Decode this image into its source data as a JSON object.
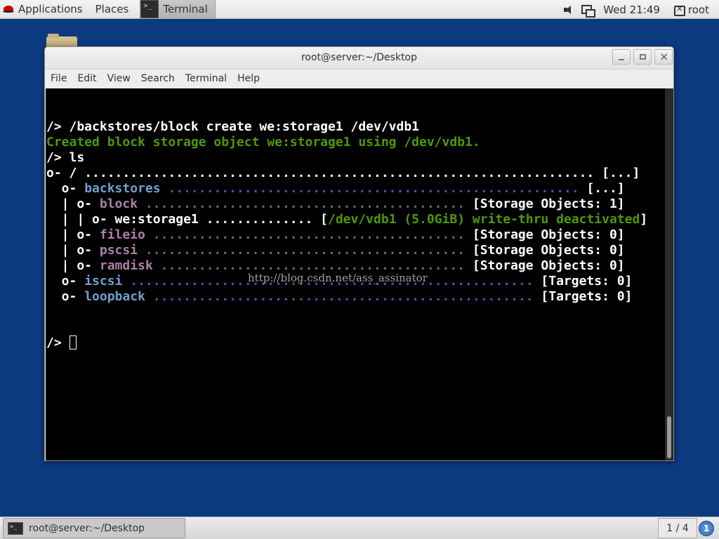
{
  "topbar": {
    "applications": "Applications",
    "places": "Places",
    "terminal_task": "Terminal",
    "clock": "Wed 21:49",
    "user": "root"
  },
  "window": {
    "title": "root@server:~/Desktop",
    "menus": [
      "File",
      "Edit",
      "View",
      "Search",
      "Terminal",
      "Help"
    ]
  },
  "terminal": {
    "lines": [
      {
        "segments": [
          {
            "text": "/> /backstores/block create we:storage1 /dev/vdb1",
            "color": "white"
          }
        ]
      },
      {
        "segments": [
          {
            "text": "Created block storage object we:storage1 using /dev/vdb1.",
            "color": "green"
          }
        ]
      },
      {
        "segments": [
          {
            "text": "/> ls",
            "color": "white"
          }
        ]
      },
      {
        "segments": [
          {
            "text": "o- / ",
            "color": "white"
          },
          {
            "text": "................................................................... ",
            "color": "white"
          },
          {
            "text": "[...]",
            "color": "white"
          }
        ]
      },
      {
        "segments": [
          {
            "text": "  o- ",
            "color": "white"
          },
          {
            "text": "backstores",
            "color": "blue"
          },
          {
            "text": " ...................................................... ",
            "color": "dots-blue"
          },
          {
            "text": "[...]",
            "color": "white"
          }
        ]
      },
      {
        "segments": [
          {
            "text": "  | o- ",
            "color": "white"
          },
          {
            "text": "block",
            "color": "purple"
          },
          {
            "text": " .......................................... ",
            "color": "dots-gray"
          },
          {
            "text": "[Storage Objects: 1]",
            "color": "white"
          }
        ]
      },
      {
        "segments": [
          {
            "text": "  | | o- ",
            "color": "white"
          },
          {
            "text": "we:storage1",
            "color": "white"
          },
          {
            "text": " .............. ",
            "color": "white"
          },
          {
            "text": "[",
            "color": "white"
          },
          {
            "text": "/dev/vdb1 (5.0GiB) write-thru deactivated",
            "color": "green"
          },
          {
            "text": "]",
            "color": "white"
          }
        ]
      },
      {
        "segments": [
          {
            "text": "  | o- ",
            "color": "white"
          },
          {
            "text": "fileio",
            "color": "purple"
          },
          {
            "text": " ......................................... ",
            "color": "dots-gray"
          },
          {
            "text": "[Storage Objects: 0]",
            "color": "white"
          }
        ]
      },
      {
        "segments": [
          {
            "text": "  | o- ",
            "color": "white"
          },
          {
            "text": "pscsi",
            "color": "purple"
          },
          {
            "text": " .......................................... ",
            "color": "dots-gray"
          },
          {
            "text": "[Storage Objects: 0]",
            "color": "white"
          }
        ]
      },
      {
        "segments": [
          {
            "text": "  | o- ",
            "color": "white"
          },
          {
            "text": "ramdisk",
            "color": "purple"
          },
          {
            "text": " ........................................ ",
            "color": "dots-gray"
          },
          {
            "text": "[Storage Objects: 0]",
            "color": "white"
          }
        ]
      },
      {
        "segments": [
          {
            "text": "  o- ",
            "color": "white"
          },
          {
            "text": "iscsi",
            "color": "blue"
          },
          {
            "text": " ..................................................... ",
            "color": "dots-blue"
          },
          {
            "text": "[Targets: 0]",
            "color": "white"
          }
        ]
      },
      {
        "segments": [
          {
            "text": "  o- ",
            "color": "white"
          },
          {
            "text": "loopback",
            "color": "blue"
          },
          {
            "text": " .................................................. ",
            "color": "dots-blue"
          },
          {
            "text": "[Targets: 0]",
            "color": "white"
          }
        ]
      }
    ],
    "prompt": "/> ",
    "watermark": "http://blog.csdn.net/ass_assinator"
  },
  "bottombar": {
    "task_label": "root@server:~/Desktop",
    "workspace": "1 / 4",
    "notification_count": "1"
  },
  "colors": {
    "desktop": "#0b3a7e",
    "terminal_bg": "#000000",
    "green": "#4e9a06",
    "blue": "#729fcf",
    "purple": "#ad7fa8"
  }
}
